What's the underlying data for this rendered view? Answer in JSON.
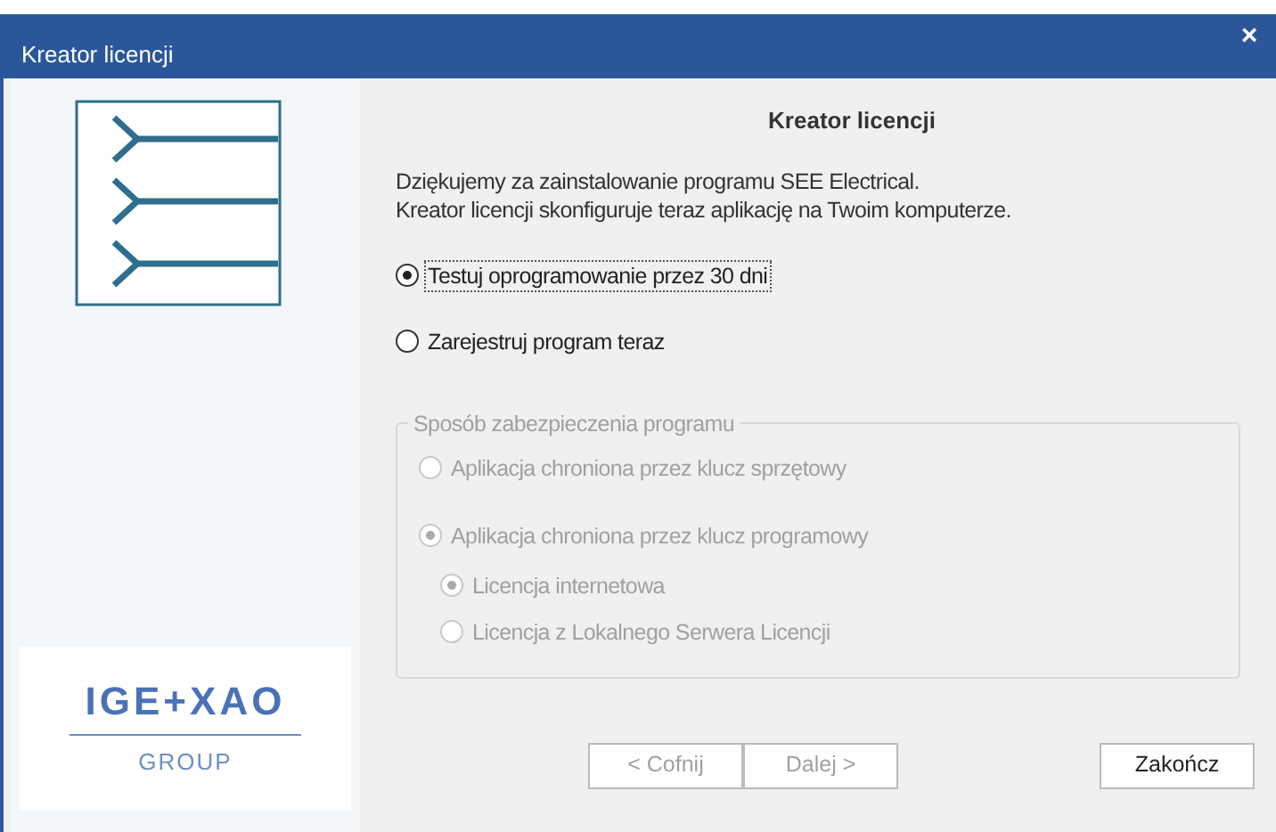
{
  "window": {
    "title": "Kreator licencji",
    "close": "×"
  },
  "logo": {
    "name": "IGE+XAO",
    "subtitle": "GROUP"
  },
  "heading": "Kreator licencji",
  "intro": [
    "Dziękujemy za zainstalowanie programu SEE Electrical.",
    "Kreator licencji skonfiguruje teraz aplikację na Twoim komputerze."
  ],
  "options": [
    {
      "label": "Testuj oprogramowanie przez 30 dni",
      "selected": true,
      "focused": true
    },
    {
      "label": "Zarejestruj program teraz",
      "selected": false,
      "focused": false
    }
  ],
  "protection": {
    "title": "Sposób zabezpieczenia programu",
    "disabled": true,
    "options": [
      {
        "label": "Aplikacja chroniona przez klucz sprzętowy",
        "selected": false
      },
      {
        "label": "Aplikacja chroniona przez klucz programowy",
        "selected": true,
        "children": [
          {
            "label": "Licencja internetowa",
            "selected": true
          },
          {
            "label": "Licencja z Lokalnego Serwera Licencji",
            "selected": false
          }
        ]
      }
    ]
  },
  "buttons": [
    {
      "label": "< Cofnij",
      "disabled": true
    },
    {
      "label": "Dalej >",
      "disabled": true
    },
    {
      "label": "Zakończ",
      "disabled": false
    }
  ]
}
